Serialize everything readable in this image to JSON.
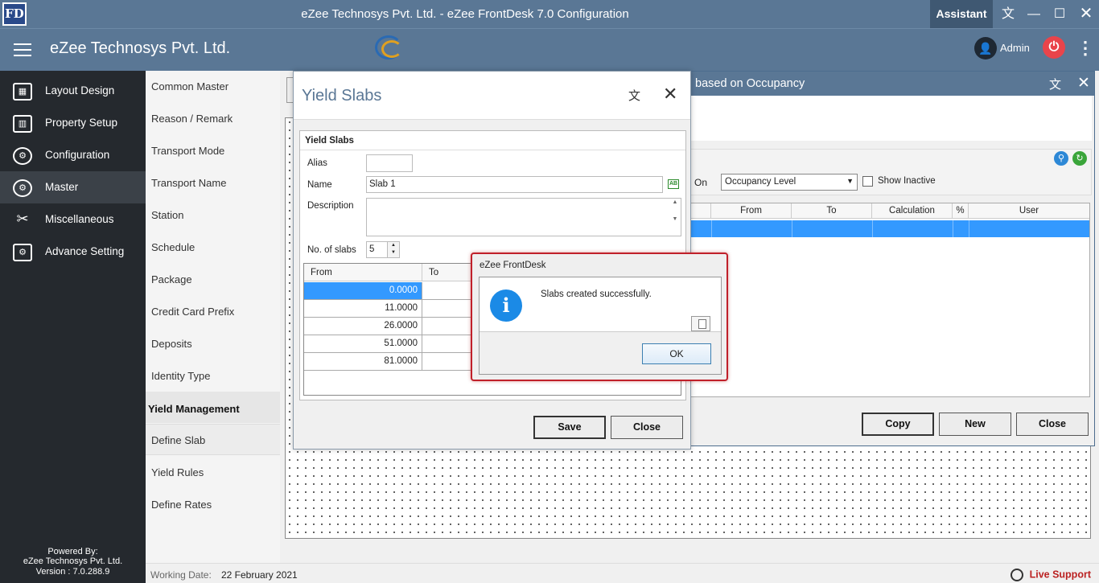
{
  "app": {
    "logo_text": "FD",
    "window_title": "eZee Technosys Pvt. Ltd. - eZee FrontDesk 7.0 Configuration",
    "assistant_label": "Assistant",
    "company_name": "eZee Technosys Pvt. Ltd.",
    "user_name": "Admin"
  },
  "sidebar": {
    "items": [
      {
        "label": "Layout Design",
        "icon": "layout-icon"
      },
      {
        "label": "Property Setup",
        "icon": "building-icon"
      },
      {
        "label": "Configuration",
        "icon": "gear-icon"
      },
      {
        "label": "Master",
        "icon": "gears-icon"
      },
      {
        "label": "Miscellaneous",
        "icon": "tools-icon"
      },
      {
        "label": "Advance Setting",
        "icon": "advance-settings-icon"
      }
    ],
    "powered_by": "Powered By:",
    "powered_company": "eZee Technosys Pvt. Ltd.",
    "version": "Version : 7.0.288.9"
  },
  "subnav": {
    "items": [
      "Common Master",
      "Reason / Remark",
      "Transport Mode",
      "Transport Name",
      "Station",
      "Schedule",
      "Package",
      "Credit Card Prefix",
      "Deposits",
      "Identity Type"
    ],
    "section": "Yield Management",
    "section_items": [
      "Define Slab",
      "Yield Rules",
      "Define Rates"
    ]
  },
  "status": {
    "working_date_label": "Working Date:",
    "working_date": "22 February 2021",
    "live_support": "Live Support"
  },
  "occupancy_window": {
    "title": "based on Occupancy",
    "on_label": "On",
    "combo_value": "Occupancy Level",
    "show_inactive": "Show Inactive",
    "columns": [
      "From",
      "To",
      "Calculation",
      "%",
      "User"
    ],
    "buttons": {
      "copy": "Copy",
      "new": "New",
      "close": "Close"
    }
  },
  "yield_window": {
    "title": "Yield Slabs",
    "group_title": "Yield Slabs",
    "alias_label": "Alias",
    "alias_value": "",
    "name_label": "Name",
    "name_value": "Slab 1",
    "description_label": "Description",
    "description_value": "",
    "slabs_label": "No. of slabs",
    "slabs_value": "5",
    "grid_columns": [
      "From",
      "To"
    ],
    "rows": [
      "0.0000",
      "11.0000",
      "26.0000",
      "51.0000",
      "81.0000"
    ],
    "buttons": {
      "save": "Save",
      "close": "Close"
    }
  },
  "message_box": {
    "title": "eZee FrontDesk",
    "message": "Slabs created successfully.",
    "ok": "OK"
  },
  "colors": {
    "header": "#5a7795",
    "sidebar": "#25292e",
    "selection": "#3399ff",
    "alert_border": "#c0202a",
    "live_support": "#b22222"
  }
}
